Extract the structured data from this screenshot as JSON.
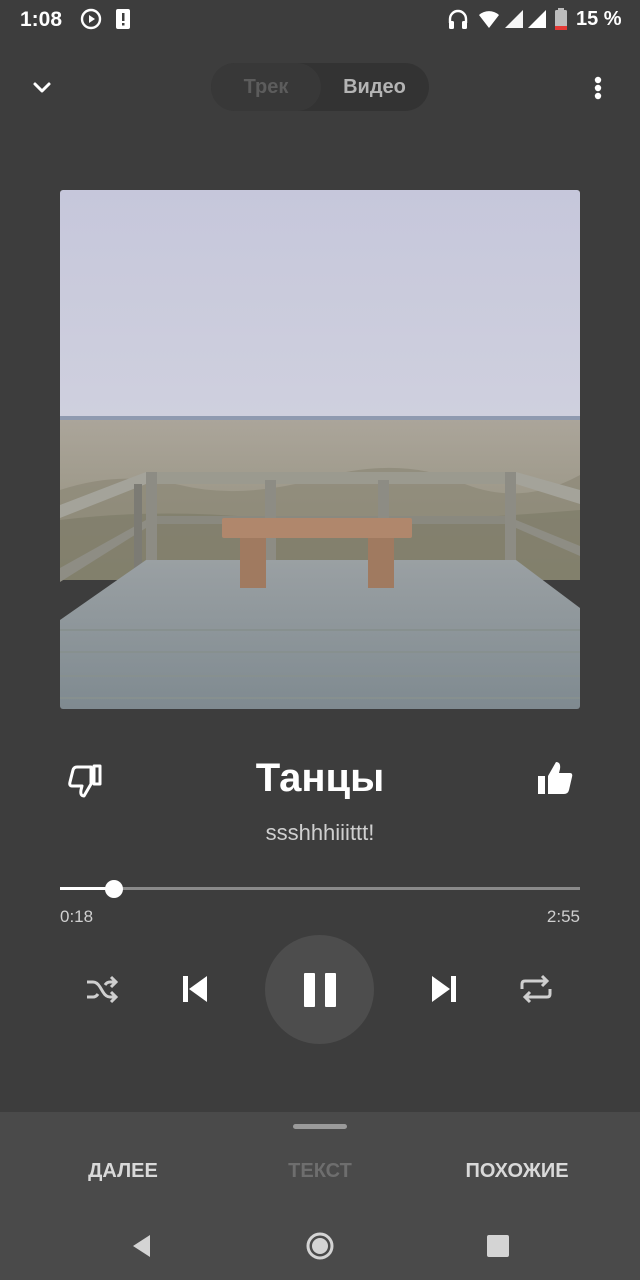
{
  "status_bar": {
    "time": "1:08",
    "battery_text": "15 %",
    "icons": [
      "play-circle-icon",
      "alert-icon",
      "headphones-icon",
      "wifi-icon",
      "signal-icon",
      "signal-icon",
      "battery-icon"
    ]
  },
  "header": {
    "tabs": [
      {
        "label": "Трек",
        "selected": false
      },
      {
        "label": "Видео",
        "selected": true
      }
    ]
  },
  "track": {
    "title": "Танцы",
    "artist": "ssshhhiiittt!",
    "position": "0:18",
    "duration": "2:55",
    "progress_fraction": 0.103,
    "liked": true,
    "disliked": false,
    "playing": true
  },
  "bottom_tabs": [
    {
      "label": "ДАЛЕЕ",
      "active": true
    },
    {
      "label": "ТЕКСТ",
      "active": false
    },
    {
      "label": "ПОХОЖИЕ",
      "active": true
    }
  ],
  "colors": {
    "background": "#3d3d3d",
    "sheet": "#4a4a4a",
    "text_primary": "#ffffff",
    "text_secondary": "#cfcfcf",
    "text_disabled": "#6e6e6e"
  }
}
